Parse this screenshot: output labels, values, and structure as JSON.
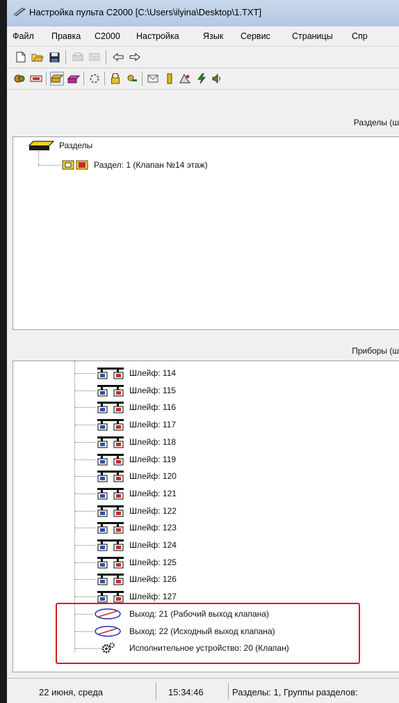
{
  "window": {
    "title": "Настройка пульта С2000 [C:\\Users\\ilyina\\Desktop\\1.TXT]"
  },
  "menu": [
    "Файл",
    "Правка",
    "С2000",
    "Настройка",
    "Язык",
    "Сервис",
    "Страницы",
    "Спр"
  ],
  "toolbar1": [
    "new-file-icon",
    "open-folder-icon",
    "save-disk-icon",
    "disabled-icon",
    "disabled-icon",
    "arrow-left-icon",
    "arrow-right-icon"
  ],
  "toolbar2": [
    "devices-icon",
    "panel-icon",
    "sections-icon",
    "section-groups-icon",
    "loop-icon",
    "lock-icon",
    "keys-icon",
    "message-icon",
    "output-icon",
    "relay-icon",
    "lightning-icon",
    "sound-icon"
  ],
  "sections_pane": {
    "header": "Разделы (ш",
    "root_label": "Разделы",
    "items": [
      "Раздел: 1 (Клапан №14 этаж)"
    ]
  },
  "devices_pane": {
    "header": "Приборы (ш",
    "loops": [
      "Шлейф: 114",
      "Шлейф: 115",
      "Шлейф: 116",
      "Шлейф: 117",
      "Шлейф: 118",
      "Шлейф: 119",
      "Шлейф: 120",
      "Шлейф: 121",
      "Шлейф: 122",
      "Шлейф: 123",
      "Шлейф: 124",
      "Шлейф: 125",
      "Шлейф: 126",
      "Шлейф: 127"
    ],
    "outputs": [
      "Выход: 21 (Рабочий выход клапана)",
      "Выход: 22 (Исходный выход клапана)"
    ],
    "actuator": "Исполнительное устройство: 20 (Клапан)"
  },
  "status": {
    "date": "22 июня, среда",
    "time": "15:34:46",
    "info": "Разделы: 1, Группы разделов:"
  },
  "colors": {
    "highlight": "#d51a1a",
    "title_bar": "#c9d9ec"
  }
}
